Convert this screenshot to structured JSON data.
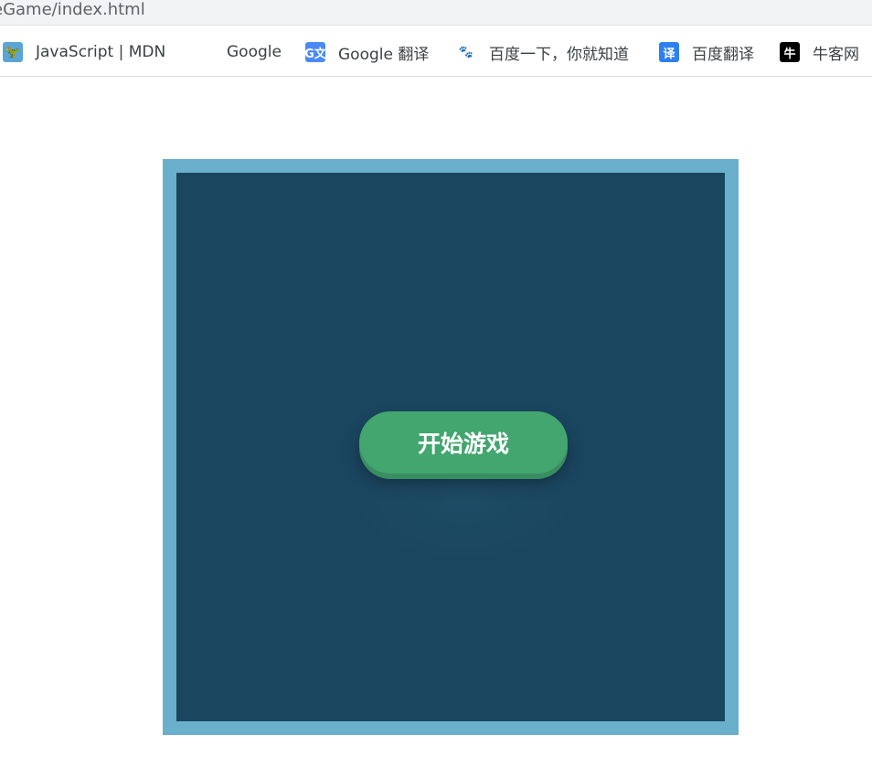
{
  "browser": {
    "url_fragment": "eGame/index.html"
  },
  "bookmarks": [
    {
      "label": "JavaScript | MDN",
      "icon": "mdn-dinosaur-icon"
    },
    {
      "label": "Google",
      "icon": "google-g-icon"
    },
    {
      "label": "Google 翻译",
      "icon": "google-translate-icon"
    },
    {
      "label": "百度一下，你就知道",
      "icon": "baidu-paw-icon"
    },
    {
      "label": "百度翻译",
      "icon": "baidu-translate-icon"
    },
    {
      "label": "牛客网",
      "icon": "nowcoder-icon"
    }
  ],
  "game": {
    "start_label": "开始游戏"
  },
  "colors": {
    "frame": "#6aafcb",
    "board": "#1b4660",
    "button": "#42a66e"
  }
}
